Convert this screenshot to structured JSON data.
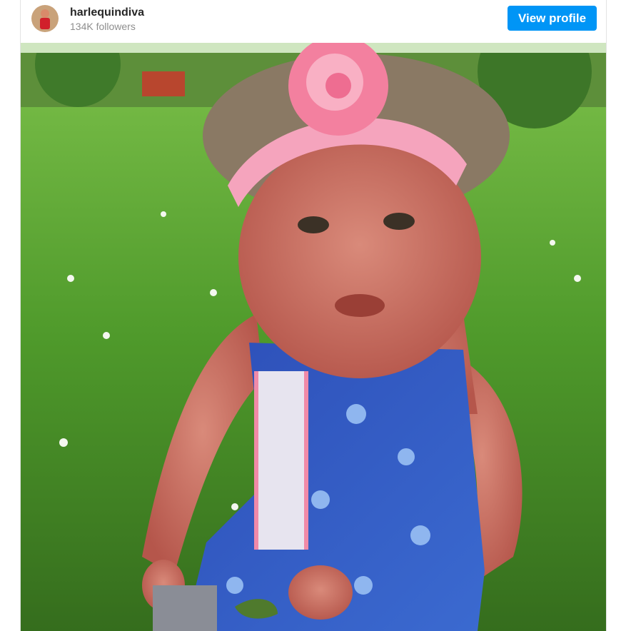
{
  "post_header": {
    "username": "harlequindiva",
    "followers": "134K followers",
    "view_profile_label": "View profile"
  },
  "post_image": {
    "alt": ""
  },
  "colors": {
    "button_blue": "#0095f6",
    "username_text": "#262626",
    "muted_text": "#8e8e8e"
  }
}
